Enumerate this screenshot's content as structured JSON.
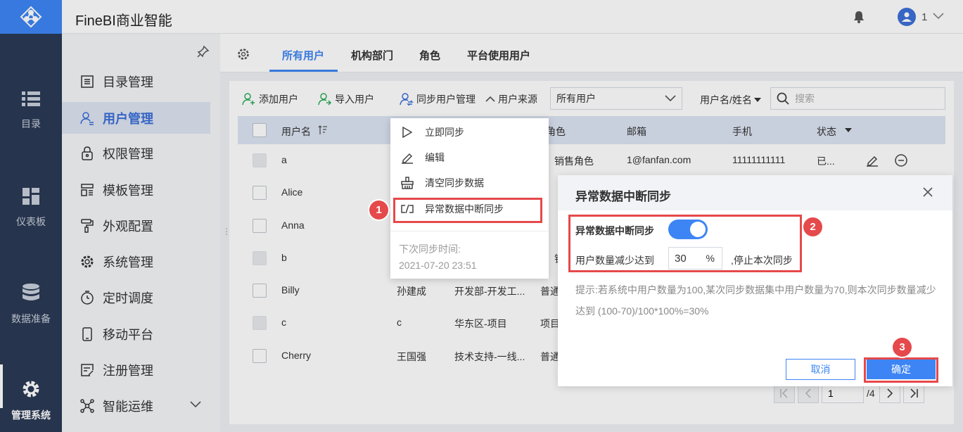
{
  "app": {
    "title": "FineBI商业智能",
    "user": "1"
  },
  "rail": {
    "items": [
      {
        "label": "目录",
        "icon": "list-icon"
      },
      {
        "label": "仪表板",
        "icon": "dashboard-icon"
      },
      {
        "label": "数据准备",
        "icon": "database-icon"
      },
      {
        "label": "管理系统",
        "icon": "gear-icon",
        "active": true
      }
    ]
  },
  "sidebar": {
    "items": [
      {
        "label": "目录管理",
        "icon": "directory-icon"
      },
      {
        "label": "用户管理",
        "icon": "user-icon",
        "active": true
      },
      {
        "label": "权限管理",
        "icon": "lock-icon"
      },
      {
        "label": "模板管理",
        "icon": "template-icon"
      },
      {
        "label": "外观配置",
        "icon": "paint-roller-icon"
      },
      {
        "label": "系统管理",
        "icon": "gear-icon"
      },
      {
        "label": "定时调度",
        "icon": "timer-icon"
      },
      {
        "label": "移动平台",
        "icon": "mobile-icon"
      },
      {
        "label": "注册管理",
        "icon": "register-icon"
      },
      {
        "label": "智能运维",
        "icon": "network-icon"
      }
    ]
  },
  "tabs": [
    "所有用户",
    "机构部门",
    "角色",
    "平台使用用户"
  ],
  "toolbar": {
    "add_user": "添加用户",
    "import_user": "导入用户",
    "sync_manage": "同步用户管理",
    "source_label": "用户来源",
    "source_value": "所有用户",
    "search_type": "用户名/姓名",
    "search_placeholder": "搜索"
  },
  "table": {
    "columns": [
      "用户名",
      "角色",
      "邮箱",
      "手机",
      "状态"
    ],
    "rows": [
      {
        "username": "a",
        "name": "",
        "dept": "",
        "role": "销售角色",
        "email": "1@fanfan.com",
        "phone": "11111111111",
        "status": "已...",
        "checkbox_disabled": true
      },
      {
        "username": "Alice",
        "name": "",
        "dept": "",
        "role": "",
        "email": "",
        "phone": "",
        "status": "",
        "checkbox_disabled": false
      },
      {
        "username": "Anna",
        "name": "",
        "dept": "",
        "role": "",
        "email": "",
        "phone": "",
        "status": "",
        "checkbox_disabled": false
      },
      {
        "username": "b",
        "name": "",
        "dept": "",
        "role": "销售",
        "email": "",
        "phone": "",
        "status": "",
        "checkbox_disabled": true
      },
      {
        "username": "Billy",
        "name": "孙建成",
        "dept": "开发部-开发工...",
        "role": "普通",
        "email": "",
        "phone": "",
        "status": "",
        "checkbox_disabled": false
      },
      {
        "username": "c",
        "name": "c",
        "dept": "华东区-项目",
        "role": "项目",
        "email": "",
        "phone": "",
        "status": "",
        "checkbox_disabled": true
      },
      {
        "username": "Cherry",
        "name": "王国强",
        "dept": "技术支持-一线...",
        "role": "普通",
        "email": "",
        "phone": "",
        "status": "",
        "checkbox_disabled": false
      }
    ]
  },
  "pagination": {
    "current": "1",
    "total": "/4"
  },
  "sync_menu": {
    "items": [
      {
        "label": "立即同步",
        "icon": "play-icon"
      },
      {
        "label": "编辑",
        "icon": "pencil-icon"
      },
      {
        "label": "清空同步数据",
        "icon": "clear-icon"
      },
      {
        "label": "异常数据中断同步",
        "icon": "break-link-icon"
      }
    ],
    "next_sync_label": "下次同步时间:",
    "next_sync_time": "2021-07-20 23:51"
  },
  "modal": {
    "title": "异常数据中断同步",
    "option_label": "异常数据中断同步",
    "enabled": true,
    "threshold_label": "用户数量减少达到",
    "threshold_value": "30",
    "threshold_unit": "%",
    "threshold_suffix": ",停止本次同步",
    "hint": "提示:若系统中用户数量为100,某次同步数据集中用户数量为70,则本次同步数量减少达到 (100-70)/100*100%=30%",
    "cancel": "取消",
    "confirm": "确定"
  },
  "callouts": [
    "1",
    "2",
    "3"
  ],
  "colors": {
    "accent": "#3d85f5",
    "rail": "#2b3a55",
    "highlight": "#e5494b"
  }
}
